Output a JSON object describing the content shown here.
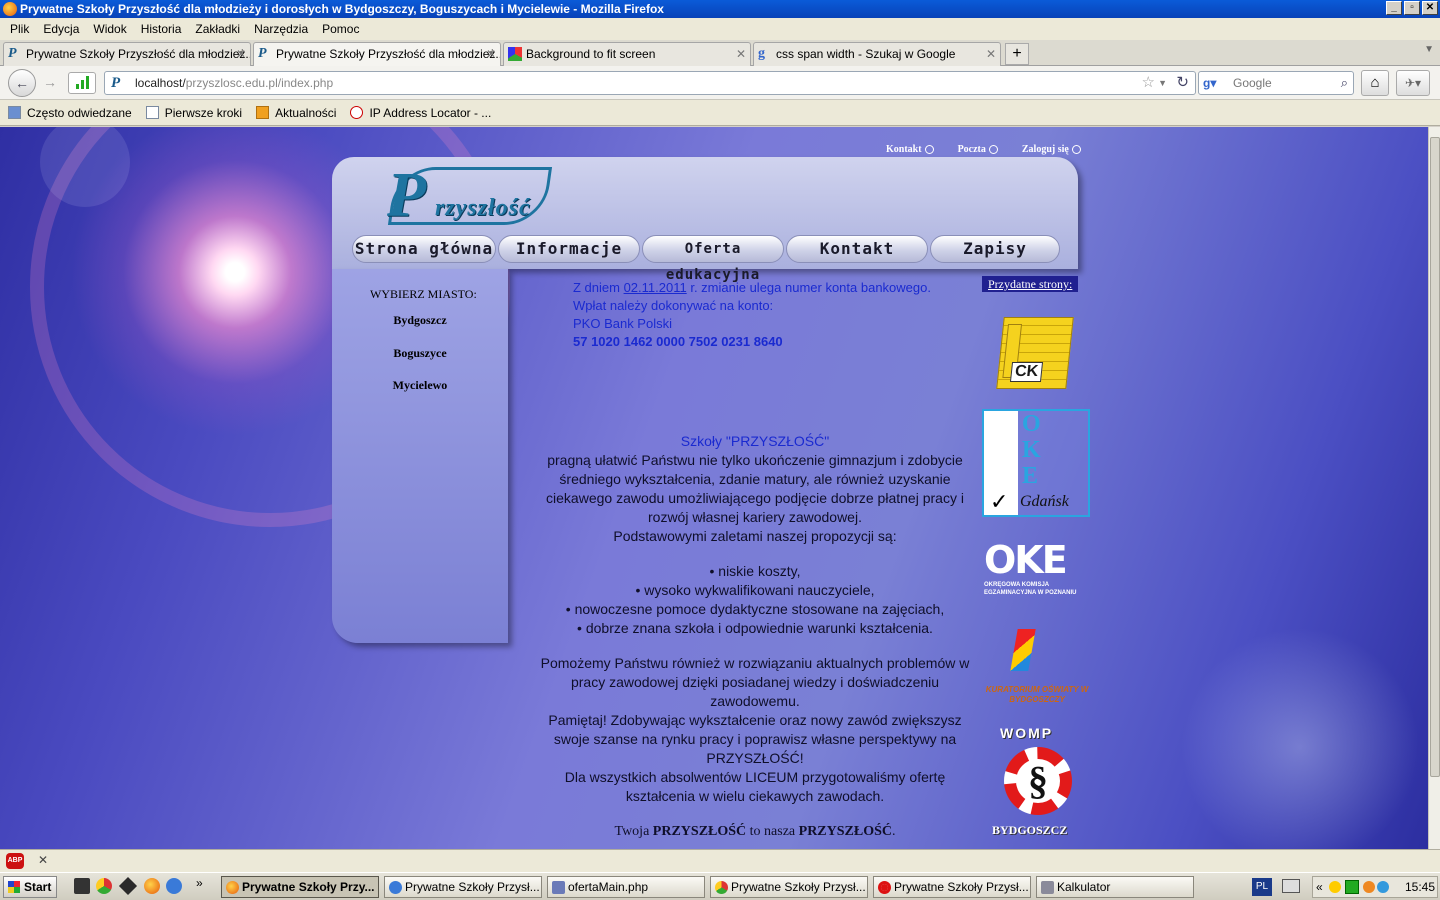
{
  "window": {
    "title": "Prywatne Szkoły Przyszłość dla młodzieży i dorosłych w Bydgoszczy, Boguszycach i Mycielewie - Mozilla Firefox"
  },
  "menu": [
    "Plik",
    "Edycja",
    "Widok",
    "Historia",
    "Zakładki",
    "Narzędzia",
    "Pomoc"
  ],
  "tabs": [
    {
      "label": "Prywatne Szkoły Przyszłość dla młodzież...",
      "active": false
    },
    {
      "label": "Prywatne Szkoły Przyszłość dla młodzież...",
      "active": true
    },
    {
      "label": "Background to fit screen",
      "active": false
    },
    {
      "label": "css span width - Szukaj w Google",
      "active": false
    }
  ],
  "address": {
    "host": "localhost/",
    "path": "przyszlosc.edu.pl/index.php"
  },
  "search": {
    "placeholder": "Google"
  },
  "bookmarks": [
    "Często odwiedzane",
    "Pierwsze kroki",
    "Aktualności",
    "IP Address Locator - ..."
  ],
  "site": {
    "toplinks": [
      "Kontakt",
      "Poczta",
      "Zaloguj się"
    ],
    "logo": {
      "big": "P",
      "small": "rzyszłość"
    },
    "nav": [
      "Strona główna",
      "Informacje",
      "Oferta edukacyjna",
      "Kontakt",
      "Zapisy"
    ],
    "left": {
      "header": "WYBIERZ MIASTO:",
      "cities": [
        "Bydgoszcz",
        "Boguszyce",
        "Mycielewo"
      ]
    },
    "news": {
      "line1_a": "Z dniem ",
      "line1_date": "02.11.2011",
      "line1_b": " r. zmianie ulega numer konta bankowego.",
      "line2": "Wpłat należy dokonywać na konto:",
      "line3": "PKO Bank Polski",
      "account": "57 1020 1462 0000 7502 0231 8640"
    },
    "content": {
      "heading": "Szkoły \"PRZYSZŁOŚĆ\"",
      "intro": "pragną ułatwić Państwu nie tylko ukończenie gimnazjum i zdobycie średniego wykształcenia, zdanie matury, ale również uzyskanie ciekawego zawodu umożliwiającego podjęcie dobrze płatnej pracy i rozwój własnej kariery zawodowej.",
      "intro2": "Podstawowymi zaletami naszej propozycji są:",
      "bullets": [
        "niskie koszty,",
        "wysoko wykwalifikowani nauczyciele,",
        "nowoczesne pomoce dydaktyczne stosowane na zajęciach,",
        "dobrze znana szkoła i odpowiednie warunki kształcenia."
      ],
      "help": "Pomożemy Państwu również w rozwiązaniu aktualnych problemów w pracy zawodowej dzięki posiadanej wiedzy i doświadczeniu zawodowemu.",
      "remember": "Pamiętaj! Zdobywając wykształcenie oraz nowy zawód zwiększysz swoje szanse na rynku pracy i poprawisz własne perspektywy na PRZYSZŁOŚĆ!",
      "liceum": "Dla wszystkich absolwentów LICEUM przygotowaliśmy ofertę kształcenia w wielu ciekawych zawodach.",
      "footer_a": "Twoja ",
      "footer_b": "PRZYSZŁOŚĆ",
      "footer_c": " to nasza ",
      "footer_d": "PRZYSZŁOŚĆ",
      "footer_e": "."
    },
    "right": {
      "label": "Przydatne strony:",
      "ck": "CK",
      "oke": [
        "O",
        "K",
        "E"
      ],
      "oke_city": "Gdańsk",
      "oke2": "OKE",
      "oke2_sub": "OKRĘGOWA KOMISJA EGZAMINACYJNA W POZNANIU",
      "kurator": "KURATORIUM OŚWIATY W BYDGOSZCZY",
      "womp": "WOMP",
      "womp_city": "BYDGOSZCZ"
    }
  },
  "taskbar": {
    "start": "Start",
    "buttons": [
      "Prywatne Szkoły Przy...",
      "Prywatne Szkoły Przysł...",
      "ofertaMain.php",
      "Prywatne Szkoły Przysł...",
      "Prywatne Szkoły Przysł...",
      "Kalkulator"
    ],
    "lang": "PL",
    "clock": "15:45"
  }
}
